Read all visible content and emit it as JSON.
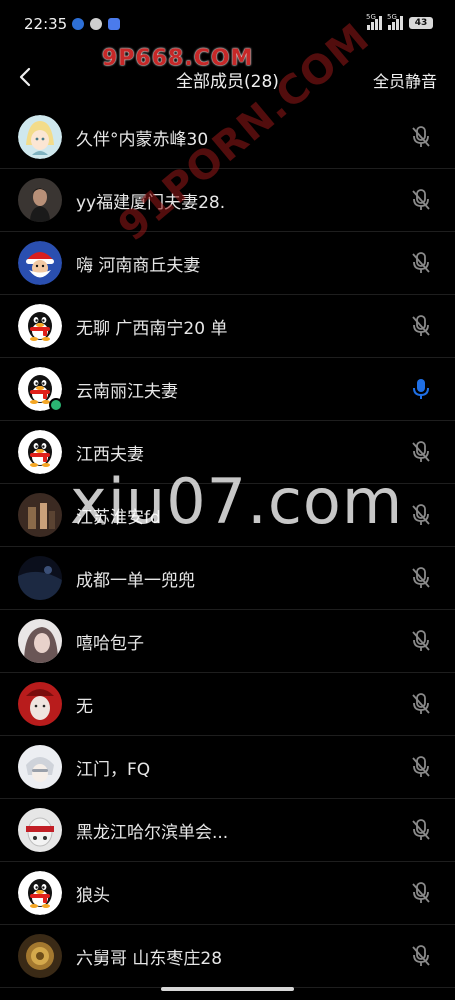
{
  "status_bar": {
    "time": "22:35",
    "signal1_tag": "5G",
    "signal2_tag": "5G",
    "battery": "43"
  },
  "watermarks": {
    "top": "9P668.COM",
    "diagonal": "91PORN.COM",
    "center": "xiu07.com"
  },
  "header": {
    "title": "全部成员(28)",
    "mute_all_label": "全员静音"
  },
  "members": [
    {
      "name": "久伴°内蒙赤峰30",
      "avatar": "anime-girl",
      "mic": "muted"
    },
    {
      "name": "yy福建厦门夫妻28.",
      "avatar": "photo-man",
      "mic": "muted"
    },
    {
      "name": "嗨 河南商丘夫妻",
      "avatar": "santa",
      "mic": "muted"
    },
    {
      "name": "无聊 广西南宁20 单",
      "avatar": "penguin",
      "mic": "muted"
    },
    {
      "name": "云南丽江夫妻",
      "avatar": "penguin",
      "mic": "active"
    },
    {
      "name": "江西夫妻",
      "avatar": "penguin",
      "mic": "muted"
    },
    {
      "name": "江苏淮安fd",
      "avatar": "photo-drinks",
      "mic": "muted"
    },
    {
      "name": "成都一单一兜兜",
      "avatar": "photo-dark",
      "mic": "muted"
    },
    {
      "name": "嘻哈包子",
      "avatar": "photo-girl",
      "mic": "muted"
    },
    {
      "name": "无",
      "avatar": "photo-red",
      "mic": "muted"
    },
    {
      "name": "江门，FQ",
      "avatar": "photo-white",
      "mic": "muted"
    },
    {
      "name": "黑龙江哈尔滨单会...",
      "avatar": "photo-mask",
      "mic": "muted"
    },
    {
      "name": "狼头",
      "avatar": "penguin",
      "mic": "muted"
    },
    {
      "name": "六舅哥  山东枣庄28",
      "avatar": "photo-gold",
      "mic": "muted"
    }
  ],
  "colors": {
    "background": "#000000",
    "muted_icon": "#8a8a8a",
    "active_mic": "#1f6fe5",
    "online": "#2bb673"
  }
}
